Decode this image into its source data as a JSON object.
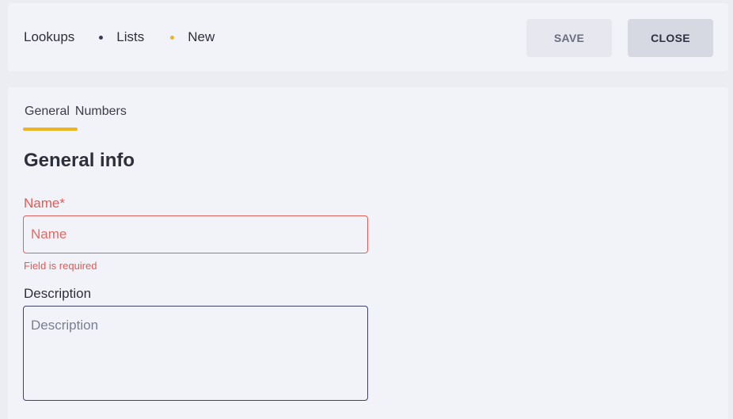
{
  "breadcrumb": {
    "items": [
      "Lookups",
      "Lists",
      "New"
    ]
  },
  "toolbar": {
    "save_label": "SAVE",
    "close_label": "CLOSE"
  },
  "tabs": [
    {
      "label": "General",
      "active": true
    },
    {
      "label": "Numbers",
      "active": false
    }
  ],
  "section": {
    "title": "General info"
  },
  "form": {
    "name": {
      "label": "Name*",
      "placeholder": "Name",
      "value": "",
      "error": "Field is required"
    },
    "description": {
      "label": "Description",
      "placeholder": "Description",
      "value": ""
    }
  },
  "colors": {
    "accent": "#f0b320",
    "error": "#e05a55",
    "text": "#2d2f3a",
    "card_bg": "#f2f3f8",
    "page_bg": "#ecedf2"
  }
}
